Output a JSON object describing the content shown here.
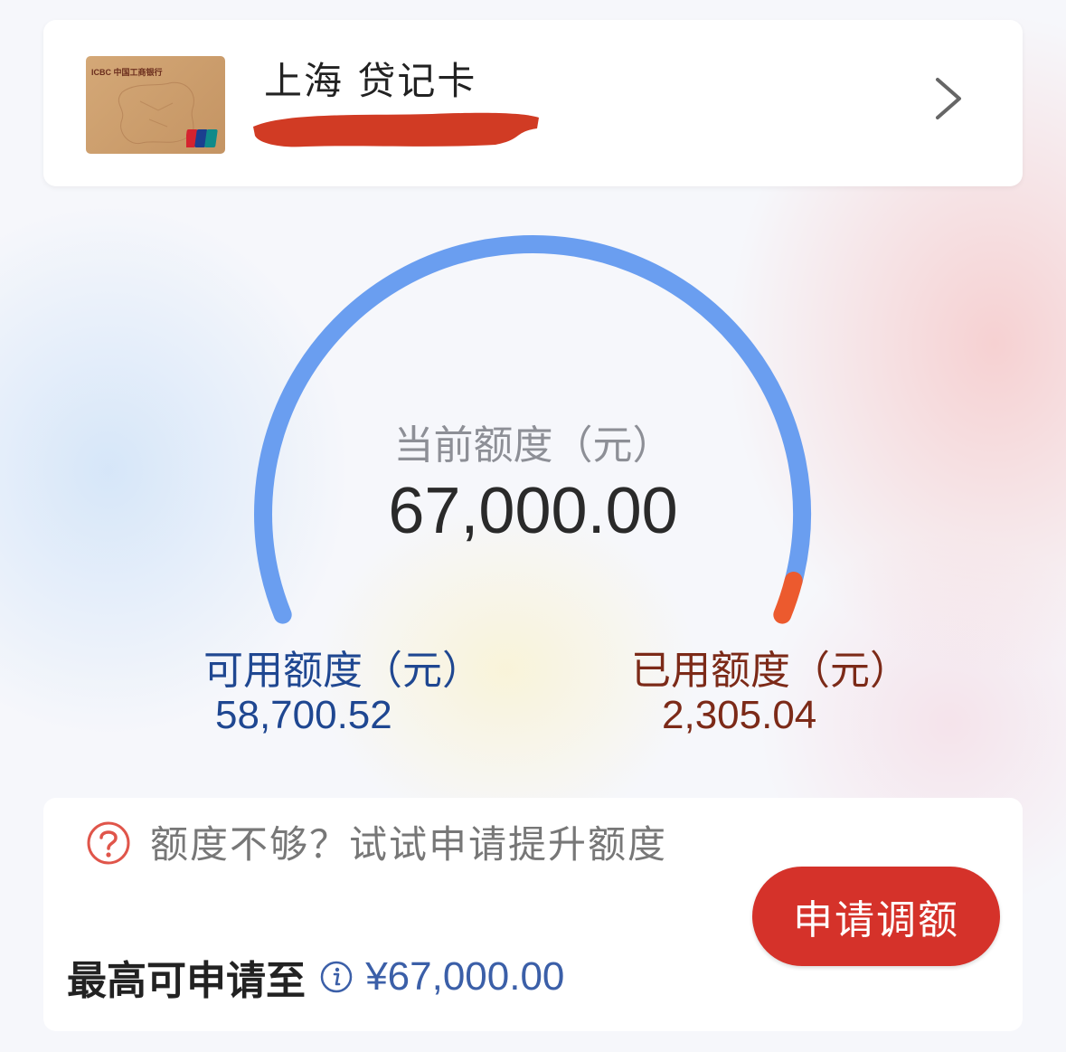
{
  "card": {
    "name": "上海 贷记卡",
    "bank_logo_text": "ICBC 中国工商银行",
    "number": ""
  },
  "credit": {
    "current_label": "当前额度（元）",
    "current_value": "67,000.00",
    "available_label": "可用额度（元）",
    "available_value": "58,700.52",
    "used_label": "已用额度（元）",
    "used_value": "2,305.04",
    "used_fraction": 0.034
  },
  "upgrade": {
    "hint": "额度不够？试试申请提升额度",
    "max_label": "最高可申请至",
    "max_value": "¥67,000.00",
    "apply_button": "申请调额"
  },
  "colors": {
    "available_arc": "#6a9ef0",
    "used_arc": "#ec5a2e",
    "button": "#d5322a",
    "available_text": "#1f4791",
    "used_text": "#7c2a18"
  },
  "icons": [
    "chevron-right-icon",
    "help-icon",
    "info-icon",
    "unionpay-logo"
  ]
}
